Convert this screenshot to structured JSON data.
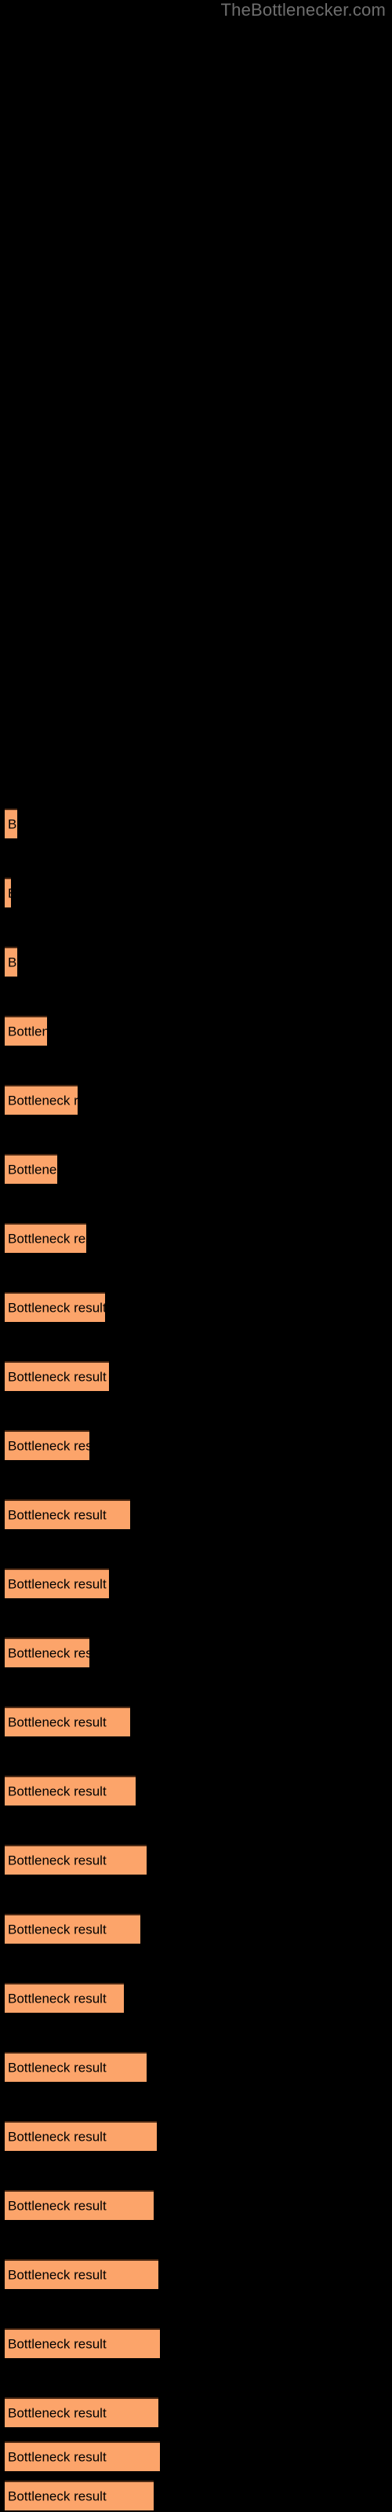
{
  "site": {
    "title": "TheBottlenecker.com"
  },
  "theme": {
    "background": "#000000",
    "bar_fill": "#fca46a",
    "bar_border": "#4d2a14",
    "bar_label_color": "#000000",
    "title_color": "#6e6e6e"
  },
  "chart_data": {
    "type": "bar",
    "orientation": "horizontal",
    "title": "TheBottlenecker.com",
    "xlabel": "",
    "ylabel": "",
    "grid": false,
    "legend": null,
    "bar_label_text": "Bottleneck result",
    "xlim": [
      0,
      500
    ],
    "categories": [
      "Bottleneck result",
      "Bottleneck result",
      "Bottleneck result",
      "Bottleneck result",
      "Bottleneck result",
      "Bottleneck result",
      "Bottleneck result",
      "Bottleneck result",
      "Bottleneck result",
      "Bottleneck result",
      "Bottleneck result",
      "Bottleneck result",
      "Bottleneck result",
      "Bottleneck result",
      "Bottleneck result",
      "Bottleneck result",
      "Bottleneck result",
      "Bottleneck result",
      "Bottleneck result",
      "Bottleneck result",
      "Bottleneck result",
      "Bottleneck result",
      "Bottleneck result",
      "Bottleneck result",
      "Bottleneck result",
      "Bottleneck result"
    ],
    "values": [
      16,
      8,
      16,
      54,
      93,
      67,
      67,
      104,
      128,
      133,
      108,
      160,
      167,
      181,
      152,
      181,
      173,
      152,
      181,
      194,
      190,
      196,
      198,
      196,
      198,
      190
    ],
    "bars": [
      {
        "index": 1,
        "label": "Bottleneck result",
        "width": 16,
        "top": 1030
      },
      {
        "index": 2,
        "label": "Bottleneck result",
        "width": 8,
        "top": 1118
      },
      {
        "index": 3,
        "label": "Bottleneck result",
        "width": 16,
        "top": 1206
      },
      {
        "index": 4,
        "label": "Bottleneck result",
        "width": 54,
        "top": 1294
      },
      {
        "index": 5,
        "label": "Bottleneck result",
        "width": 93,
        "top": 1382
      },
      {
        "index": 6,
        "label": "Bottleneck result",
        "width": 67,
        "top": 1470
      },
      {
        "index": 7,
        "label": "Bottleneck result",
        "width": 104,
        "top": 1558
      },
      {
        "index": 8,
        "label": "Bottleneck result",
        "width": 128,
        "top": 1646
      },
      {
        "index": 9,
        "label": "Bottleneck result",
        "width": 133,
        "top": 1734
      },
      {
        "index": 10,
        "label": "Bottleneck result",
        "width": 108,
        "top": 1822
      },
      {
        "index": 11,
        "label": "Bottleneck result",
        "width": 160,
        "top": 1910
      },
      {
        "index": 12,
        "label": "Bottleneck result",
        "width": 133,
        "top": 1998
      },
      {
        "index": 13,
        "label": "Bottleneck result",
        "width": 108,
        "top": 2086
      },
      {
        "index": 14,
        "label": "Bottleneck result",
        "width": 160,
        "top": 2174
      },
      {
        "index": 15,
        "label": "Bottleneck result",
        "width": 167,
        "top": 2262
      },
      {
        "index": 16,
        "label": "Bottleneck result",
        "width": 181,
        "top": 2350
      },
      {
        "index": 17,
        "label": "Bottleneck result",
        "width": 173,
        "top": 2438
      },
      {
        "index": 18,
        "label": "Bottleneck result",
        "width": 152,
        "top": 2526
      },
      {
        "index": 19,
        "label": "Bottleneck result",
        "width": 181,
        "top": 2614
      },
      {
        "index": 20,
        "label": "Bottleneck result",
        "width": 194,
        "top": 2702
      },
      {
        "index": 21,
        "label": "Bottleneck result",
        "width": 190,
        "top": 2790
      },
      {
        "index": 22,
        "label": "Bottleneck result",
        "width": 196,
        "top": 2878
      },
      {
        "index": 23,
        "label": "Bottleneck result",
        "width": 198,
        "top": 2966
      },
      {
        "index": 24,
        "label": "Bottleneck result",
        "width": 196,
        "top": 3054
      },
      {
        "index": 25,
        "label": "Bottleneck result",
        "width": 198,
        "top": 3110
      },
      {
        "index": 26,
        "label": "Bottleneck result",
        "width": 190,
        "top": 3160
      }
    ]
  }
}
